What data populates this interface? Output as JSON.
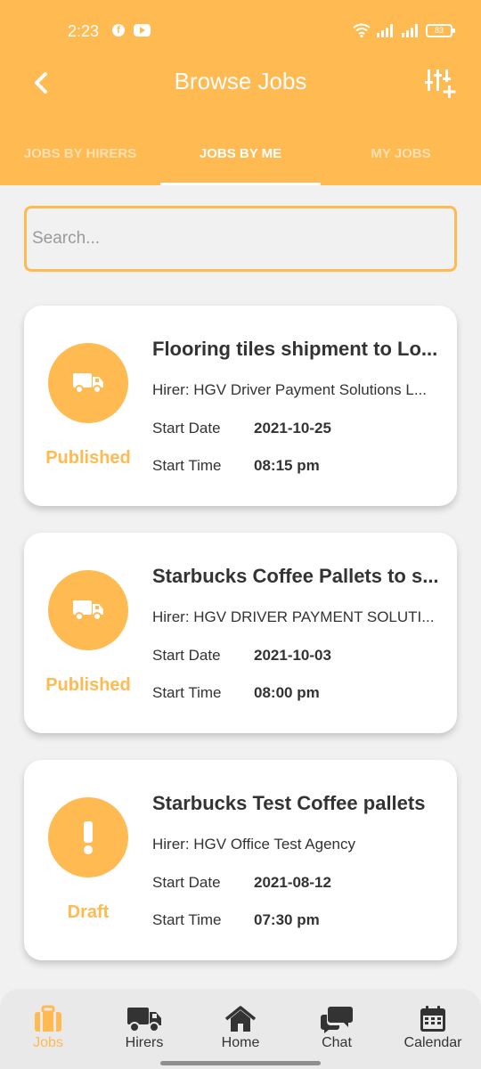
{
  "status_bar": {
    "time": "2:23",
    "battery": "83"
  },
  "header": {
    "title": "Browse Jobs"
  },
  "tabs": [
    {
      "label": "JOBS BY HIRERS",
      "active": false
    },
    {
      "label": "JOBS BY ME",
      "active": true
    },
    {
      "label": "MY JOBS",
      "active": false
    }
  ],
  "search": {
    "placeholder": "Search...",
    "value": ""
  },
  "jobs": [
    {
      "icon": "truck-icon",
      "status": "Published",
      "title": "Flooring tiles shipment to Lo...",
      "hirer": "Hirer: HGV Driver Payment Solutions L...",
      "start_date_label": "Start Date",
      "start_date": "2021-10-25",
      "start_time_label": "Start Time",
      "start_time": "08:15 pm"
    },
    {
      "icon": "truck-icon",
      "status": "Published",
      "title": "Starbucks Coffee Pallets to s...",
      "hirer": "Hirer: HGV DRIVER PAYMENT SOLUTI...",
      "start_date_label": "Start Date",
      "start_date": "2021-10-03",
      "start_time_label": "Start Time",
      "start_time": "08:00 pm"
    },
    {
      "icon": "exclamation-icon",
      "status": "Draft",
      "title": "Starbucks Test Coffee pallets",
      "hirer": "Hirer: HGV Office Test Agency",
      "start_date_label": "Start Date",
      "start_date": "2021-08-12",
      "start_time_label": "Start Time",
      "start_time": "07:30 pm"
    }
  ],
  "bottom_nav": [
    {
      "label": "Jobs",
      "icon": "briefcase-icon",
      "active": true
    },
    {
      "label": "Hirers",
      "icon": "truck-icon",
      "active": false
    },
    {
      "label": "Home",
      "icon": "home-icon",
      "active": false
    },
    {
      "label": "Chat",
      "icon": "chat-icon",
      "active": false
    },
    {
      "label": "Calendar",
      "icon": "calendar-icon",
      "active": false
    }
  ],
  "colors": {
    "accent": "#ffba52",
    "background": "#f1f1f1",
    "card": "#ffffff",
    "text": "#333333"
  }
}
